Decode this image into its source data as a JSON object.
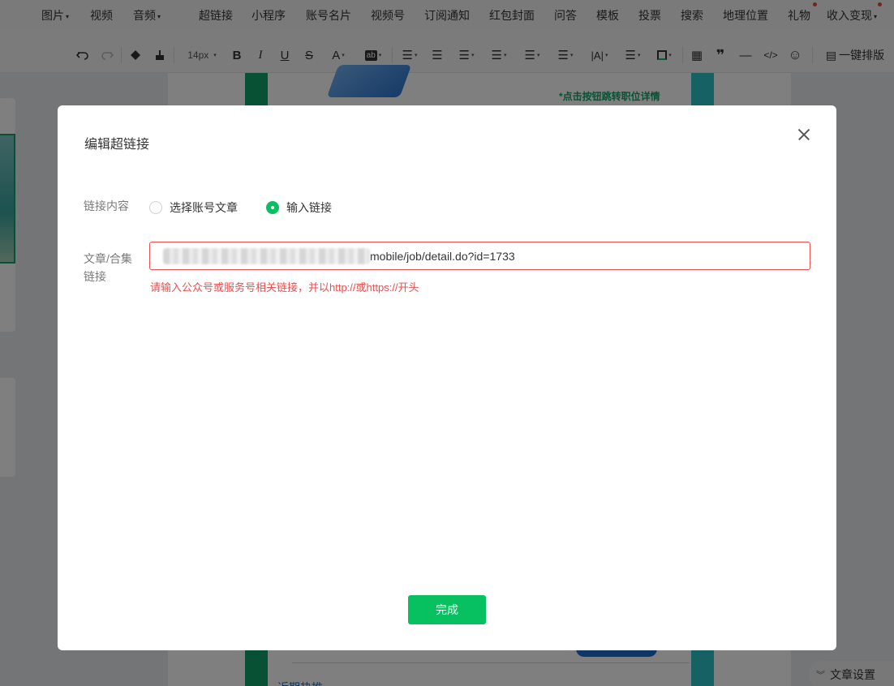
{
  "menu": {
    "items": [
      {
        "label": "图片",
        "caret": true
      },
      {
        "label": "视频",
        "caret": false
      },
      {
        "label": "音频",
        "caret": true
      },
      {
        "label": "超链接",
        "caret": false
      },
      {
        "label": "小程序",
        "caret": false
      },
      {
        "label": "账号名片",
        "caret": false
      },
      {
        "label": "视频号",
        "caret": false
      },
      {
        "label": "订阅通知",
        "caret": false
      },
      {
        "label": "红包封面",
        "caret": false
      },
      {
        "label": "问答",
        "caret": false
      },
      {
        "label": "模板",
        "caret": false
      },
      {
        "label": "投票",
        "caret": false
      },
      {
        "label": "搜索",
        "caret": false
      },
      {
        "label": "地理位置",
        "caret": false
      },
      {
        "label": "礼物",
        "caret": false,
        "dot": true
      },
      {
        "label": "收入变现",
        "caret": true,
        "dot": true
      }
    ]
  },
  "toolbar": {
    "font_size": "14px",
    "one_click_layout": "一键排版",
    "icons": [
      "undo-icon",
      "redo-icon",
      "format-painter-icon",
      "clear-format-icon",
      "font-size-select",
      "bold-icon",
      "italic-icon",
      "underline-icon",
      "strikethrough-icon",
      "font-color-icon",
      "background-color-icon",
      "align-icon",
      "indent-icon",
      "line-spacing-icon",
      "paragraph-spacing-icon",
      "letter-spacing-icon",
      "first-line-indent-icon",
      "text-direction-icon",
      "list-icon",
      "border-color-icon",
      "table-icon",
      "quote-icon",
      "divider-icon",
      "code-icon",
      "emoji-icon",
      "one-click-layout-icon"
    ]
  },
  "article": {
    "jump_text": "*点击按钮跳转职位详情",
    "more_text": "近期热推"
  },
  "settings_button": "文章设置",
  "dialog": {
    "title": "编辑超链接",
    "link_content_label": "链接内容",
    "options": [
      {
        "label": "选择账号文章",
        "checked": false
      },
      {
        "label": "输入链接",
        "checked": true
      }
    ],
    "url_label": "文章/合集链接",
    "url_value_visible": "mobile/job/detail.do?id=1733",
    "error_message": "请输入公众号或服务号相关链接，并以http://或https://开头",
    "done_label": "完成"
  },
  "colors": {
    "primary_green": "#07c160",
    "error_red": "#e84f4f",
    "overlay": "rgba(0,0,0,0.5)"
  }
}
